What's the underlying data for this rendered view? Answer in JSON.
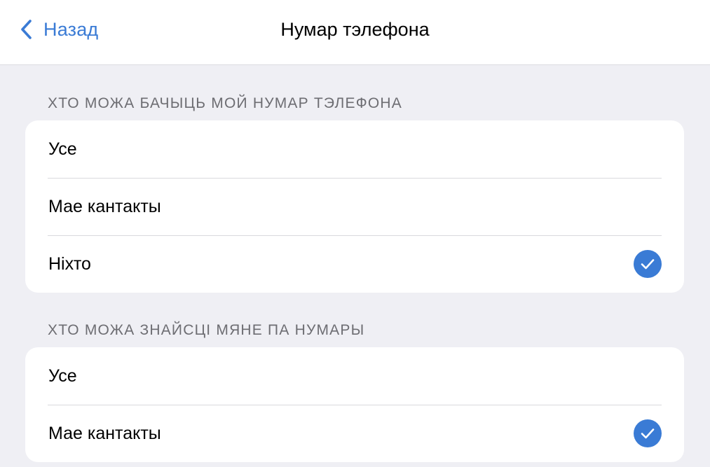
{
  "nav": {
    "back_label": "Назад",
    "title": "Нумар тэлефона"
  },
  "sections": [
    {
      "header": "ХТО МОЖА БАЧЫЦЬ МОЙ НУМАР ТЭЛЕФОНА",
      "options": [
        {
          "label": "Усе",
          "selected": false
        },
        {
          "label": "Мае кантакты",
          "selected": false
        },
        {
          "label": "Ніхто",
          "selected": true
        }
      ]
    },
    {
      "header": "ХТО МОЖА ЗНАЙСЦІ МЯНЕ ПА НУМАРЫ",
      "options": [
        {
          "label": "Усе",
          "selected": false
        },
        {
          "label": "Мае кантакты",
          "selected": true
        }
      ]
    }
  ],
  "icons": {
    "back": "chevron-left-icon",
    "selected": "checkmark-circle-icon"
  },
  "colors": {
    "accent": "#3a7bd5",
    "background": "#efeff4",
    "section_header": "#6d6d72"
  }
}
